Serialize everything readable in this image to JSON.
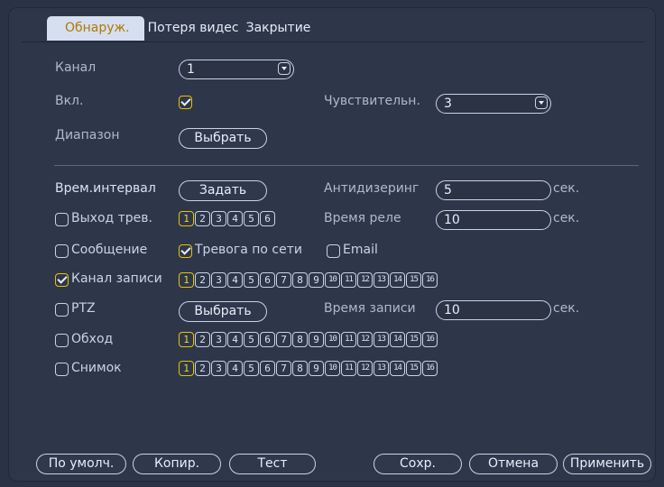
{
  "tabs": [
    "Обнаруж.",
    "Потеря видес",
    "Закрытие"
  ],
  "channel": {
    "label": "Канал",
    "value": "1"
  },
  "enable": {
    "label": "Вкл.",
    "checked": true
  },
  "sensitivity": {
    "label": "Чувствительн.",
    "value": "3"
  },
  "area": {
    "label": "Диапазон",
    "button": "Выбрать"
  },
  "period": {
    "label": "Врем.интервал",
    "button": "Задать"
  },
  "anti_dither": {
    "label": "Антидизеринг",
    "value": "5",
    "unit": "сек."
  },
  "alarm_out": {
    "label": "Выход трев.",
    "checked": false,
    "selected": [
      1
    ]
  },
  "relay_time": {
    "label": "Время реле",
    "value": "10",
    "unit": "сек."
  },
  "message": {
    "label": "Сообщение",
    "checked": false
  },
  "net_alarm": {
    "label": "Тревога по сети",
    "checked": true
  },
  "email": {
    "label": "Email",
    "checked": false
  },
  "record_channel": {
    "label": "Канал записи",
    "checked": true,
    "selected": [
      1
    ]
  },
  "ptz": {
    "label": "PTZ",
    "checked": false,
    "button": "Выбрать"
  },
  "record_time": {
    "label": "Время записи",
    "value": "10",
    "unit": "сек."
  },
  "tour": {
    "label": "Обход",
    "checked": false,
    "selected": [
      1
    ]
  },
  "snapshot": {
    "label": "Снимок",
    "checked": false,
    "selected": [
      1
    ]
  },
  "alarm_out_numbers": [
    "1",
    "2",
    "3",
    "4",
    "5",
    "6"
  ],
  "channel_numbers": [
    "1",
    "2",
    "3",
    "4",
    "5",
    "6",
    "7",
    "8",
    "9",
    "10",
    "11",
    "12",
    "13",
    "14",
    "15",
    "16"
  ],
  "buttons": {
    "default": "По умолч.",
    "copy": "Копир.",
    "test": "Тест",
    "save": "Сохр.",
    "cancel": "Отмена",
    "apply": "Применить"
  },
  "colors": {
    "accent_yellow": "#e8c300",
    "active_tab_text": "#b07a00",
    "panel_bg": "#2e374a"
  }
}
